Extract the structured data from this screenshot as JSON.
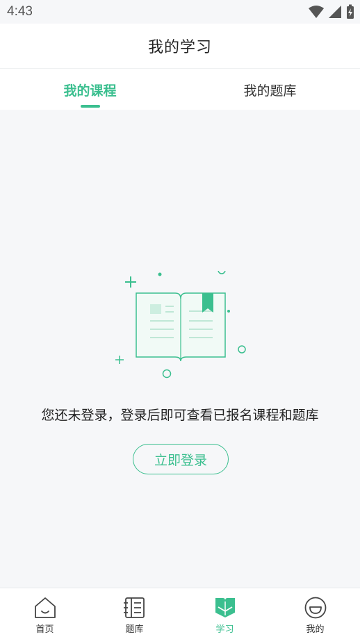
{
  "status_bar": {
    "time": "4:43"
  },
  "header": {
    "title": "我的学习"
  },
  "tabs": [
    {
      "label": "我的课程",
      "active": true
    },
    {
      "label": "我的题库",
      "active": false
    }
  ],
  "empty_state": {
    "message": "您还未登录，登录后即可查看已报名课程和题库",
    "login_label": "立即登录",
    "illustration_icon": "open-book-icon"
  },
  "bottom_nav": [
    {
      "label": "首页",
      "icon": "home-icon",
      "active": false
    },
    {
      "label": "题库",
      "icon": "question-bank-icon",
      "active": false
    },
    {
      "label": "学习",
      "icon": "study-book-icon",
      "active": true
    },
    {
      "label": "我的",
      "icon": "profile-icon",
      "active": false
    }
  ],
  "colors": {
    "accent": "#3bbf8f",
    "background": "#f6f7f9"
  }
}
